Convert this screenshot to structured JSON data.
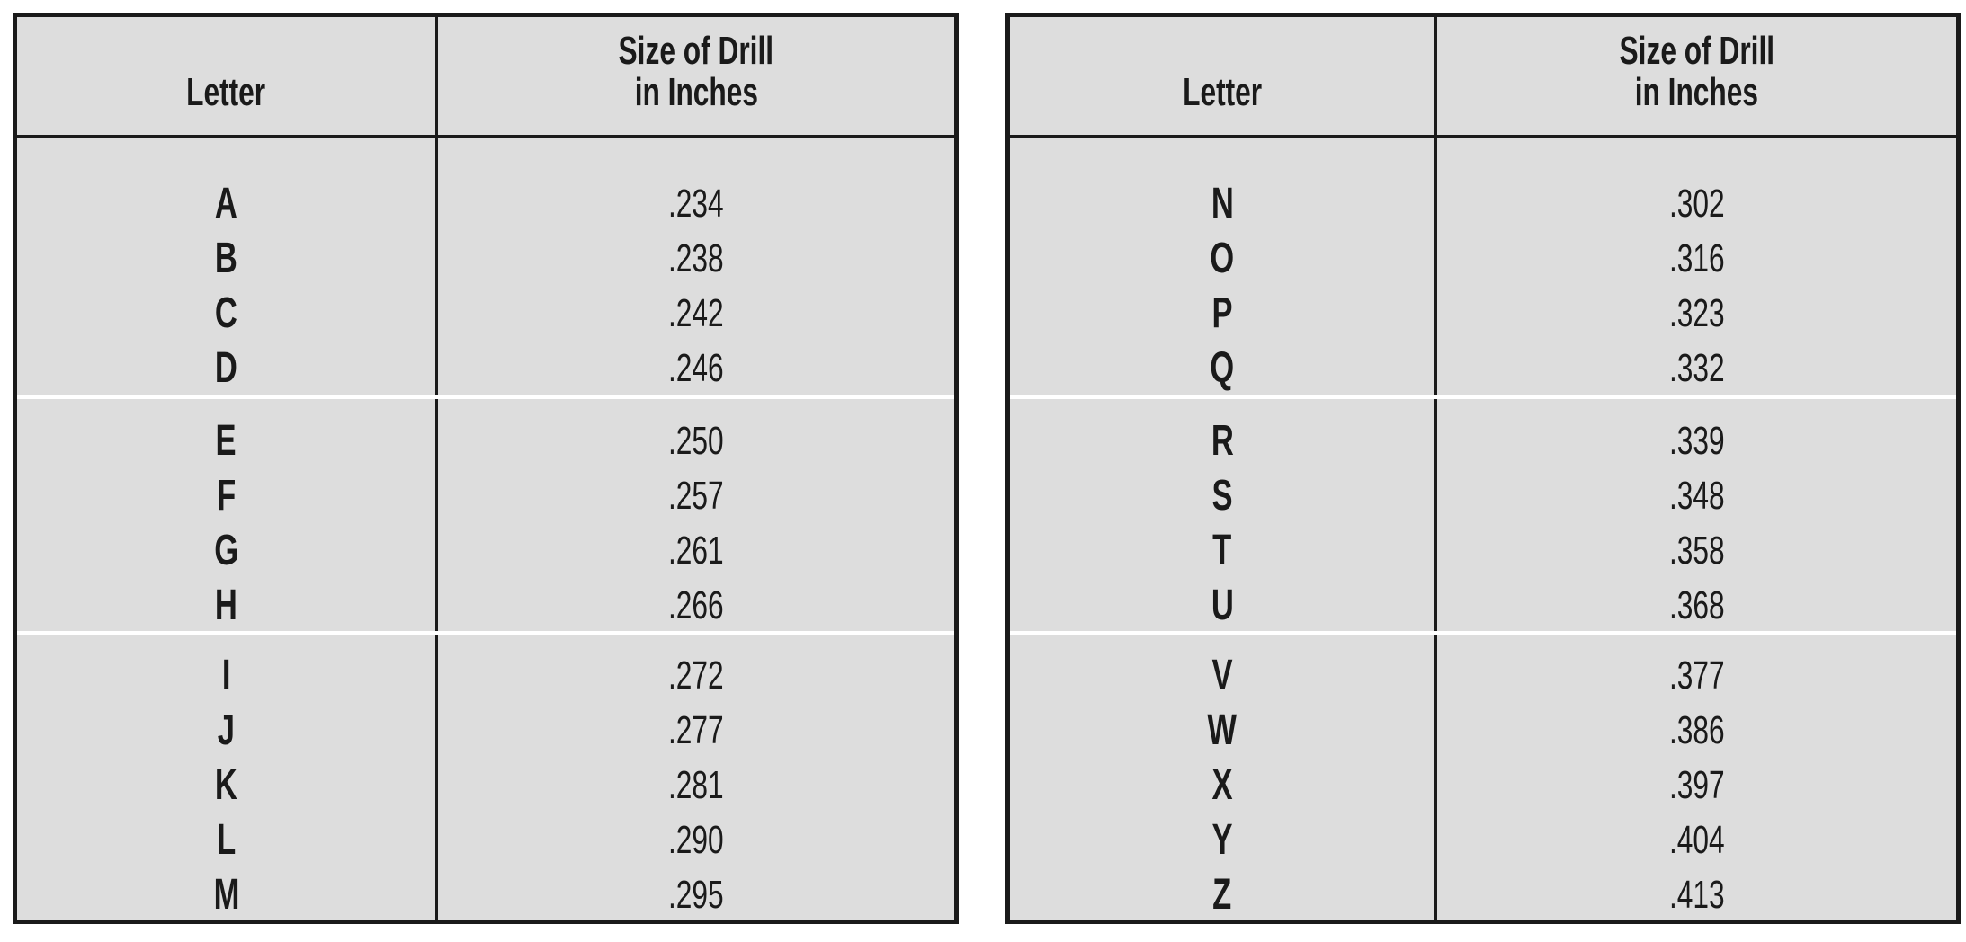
{
  "tables": [
    {
      "header": {
        "letter": "Letter",
        "size_line1": "Size of Drill",
        "size_line2": "in Inches"
      },
      "groups": [
        [
          {
            "letter": "A",
            "size": ".234"
          },
          {
            "letter": "B",
            "size": ".238"
          },
          {
            "letter": "C",
            "size": ".242"
          },
          {
            "letter": "D",
            "size": ".246"
          }
        ],
        [
          {
            "letter": "E",
            "size": ".250"
          },
          {
            "letter": "F",
            "size": ".257"
          },
          {
            "letter": "G",
            "size": ".261"
          },
          {
            "letter": "H",
            "size": ".266"
          }
        ],
        [
          {
            "letter": "I",
            "size": ".272"
          },
          {
            "letter": "J",
            "size": ".277"
          },
          {
            "letter": "K",
            "size": ".281"
          },
          {
            "letter": "L",
            "size": ".290"
          },
          {
            "letter": "M",
            "size": ".295"
          }
        ]
      ]
    },
    {
      "header": {
        "letter": "Letter",
        "size_line1": "Size of Drill",
        "size_line2": "in Inches"
      },
      "groups": [
        [
          {
            "letter": "N",
            "size": ".302"
          },
          {
            "letter": "O",
            "size": ".316"
          },
          {
            "letter": "P",
            "size": ".323"
          },
          {
            "letter": "Q",
            "size": ".332"
          }
        ],
        [
          {
            "letter": "R",
            "size": ".339"
          },
          {
            "letter": "S",
            "size": ".348"
          },
          {
            "letter": "T",
            "size": ".358"
          },
          {
            "letter": "U",
            "size": ".368"
          }
        ],
        [
          {
            "letter": "V",
            "size": ".377"
          },
          {
            "letter": "W",
            "size": ".386"
          },
          {
            "letter": "X",
            "size": ".397"
          },
          {
            "letter": "Y",
            "size": ".404"
          },
          {
            "letter": "Z",
            "size": ".413"
          }
        ]
      ]
    }
  ],
  "colors": {
    "background": "#dddddd",
    "border": "#1a1a1a",
    "group_separator": "#ffffff"
  }
}
